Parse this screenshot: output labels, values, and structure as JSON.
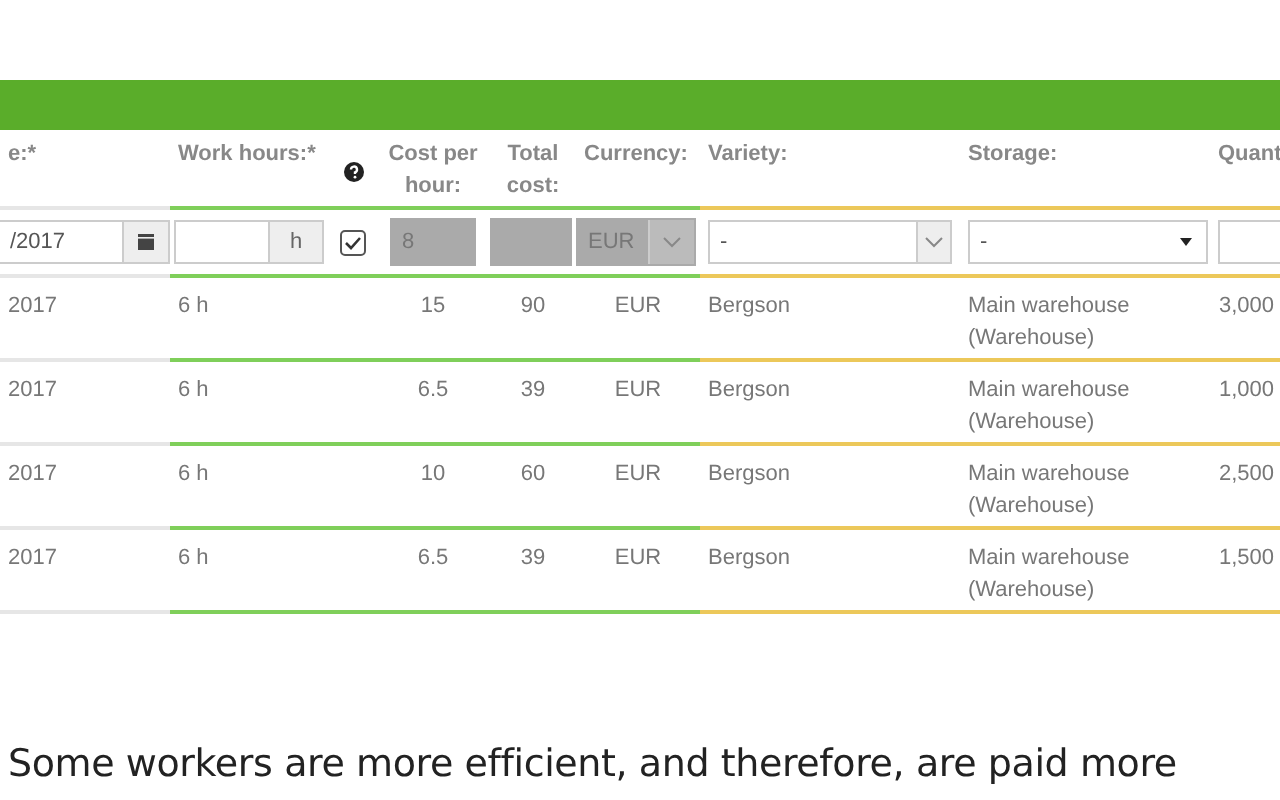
{
  "columns": [
    {
      "kind": "text",
      "label": "e:*"
    },
    {
      "kind": "text",
      "label": "Work hours:*"
    },
    {
      "kind": "help_icon"
    },
    {
      "kind": "text",
      "label": "Cost per hour:"
    },
    {
      "kind": "text",
      "label": "Total cost:"
    },
    {
      "kind": "text",
      "label": "Currency:"
    },
    {
      "kind": "text",
      "label": "Variety:"
    },
    {
      "kind": "text",
      "label": "Storage:"
    },
    {
      "kind": "text",
      "label": "Quant"
    }
  ],
  "entry_row": {
    "date": "/2017",
    "hours_unit": "h",
    "checked": true,
    "cost_per_hour": "8",
    "currency": "EUR",
    "variety": "-",
    "storage": "-"
  },
  "rows": [
    {
      "date": "2017",
      "hours": "6 h",
      "cost_per_hour": "15",
      "total_cost": "90",
      "currency": "EUR",
      "variety": "Bergson",
      "storage": "Main warehouse (Warehouse)",
      "quantity": "3,000"
    },
    {
      "date": "2017",
      "hours": "6 h",
      "cost_per_hour": "6.5",
      "total_cost": "39",
      "currency": "EUR",
      "variety": "Bergson",
      "storage": "Main warehouse (Warehouse)",
      "quantity": "1,000"
    },
    {
      "date": "2017",
      "hours": "6 h",
      "cost_per_hour": "10",
      "total_cost": "60",
      "currency": "EUR",
      "variety": "Bergson",
      "storage": "Main warehouse (Warehouse)",
      "quantity": "2,500"
    },
    {
      "date": "2017",
      "hours": "6 h",
      "cost_per_hour": "6.5",
      "total_cost": "39",
      "currency": "EUR",
      "variety": "Bergson",
      "storage": "Main warehouse (Warehouse)",
      "quantity": "1,500"
    }
  ],
  "caption": "Some workers are more efficient, and therefore, are paid more"
}
